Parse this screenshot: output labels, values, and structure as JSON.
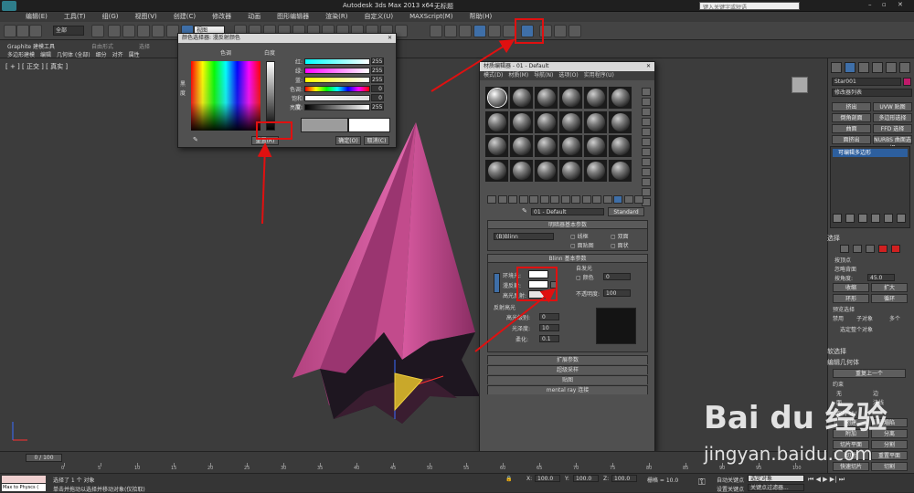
{
  "window": {
    "title": "Autodesk 3ds Max  2013 x64",
    "doc_title": "无标题",
    "search_placeholder": "键入关键字或短语"
  },
  "menu": [
    "编辑(E)",
    "工具(T)",
    "组(G)",
    "视图(V)",
    "创建(C)",
    "修改器",
    "动画",
    "图形编辑器",
    "渲染(R)",
    "自定义(U)",
    "MAXScript(M)",
    "帮助(H)"
  ],
  "toolbar": {
    "selection_filter": "全部",
    "view_dropdown": "视图"
  },
  "ribbon": {
    "tabs": [
      "Graphite 建模工具",
      "自由形式",
      "选择"
    ],
    "subtabs": [
      "多边形建模",
      "编辑",
      "几何体 (全部)",
      "细分",
      "对齐",
      "属性"
    ]
  },
  "viewport": {
    "label": "[ + ] [ 正交 ] [ 真实 ]"
  },
  "color_picker": {
    "title": "颜色选择器: 漫反射颜色",
    "hue_label": "色调",
    "whiteness_label": "白度",
    "black_label": "黑",
    "degree_label": "度",
    "sliders": [
      {
        "label": "红:",
        "value": "255"
      },
      {
        "label": "绿:",
        "value": "255"
      },
      {
        "label": "蓝:",
        "value": "255"
      },
      {
        "label": "色调:",
        "value": "0"
      },
      {
        "label": "饱和度:",
        "value": "0"
      },
      {
        "label": "亮度:",
        "value": "255"
      }
    ],
    "reset_label": "重置(R)",
    "ok_label": "确定(O)",
    "cancel_label": "取消(C)"
  },
  "material_editor": {
    "title": "材质编辑器 - 01 - Default",
    "menus": [
      "模式(D)",
      "材质(M)",
      "导航(N)",
      "选项(O)",
      "实用程序(U)"
    ],
    "material_name": "01 - Default",
    "material_type": "Standard",
    "shader_rollout": "明暗器基本参数",
    "shader": "(B)Blinn",
    "shader_options": [
      "线框",
      "双面",
      "面贴图",
      "面状"
    ],
    "blinn_rollout": "Blinn 基本参数",
    "self_illum": "自发光",
    "self_illum_color": "颜色",
    "self_illum_value": "0",
    "ambient_label": "环境光:",
    "diffuse_label": "漫反射:",
    "specular_label": "高光反射:",
    "opacity_label": "不透明度:",
    "opacity_value": "100",
    "highlight_section": "反射高光",
    "spec_level_label": "高光级别:",
    "spec_level_value": "0",
    "gloss_label": "光泽度:",
    "gloss_value": "10",
    "soften_label": "柔化:",
    "soften_value": "0.1",
    "rollouts": [
      "扩展参数",
      "超级采样",
      "贴图",
      "mental ray 连接"
    ]
  },
  "command_panel": {
    "object_name": "Star001",
    "modifier_list": "修改器列表",
    "buttons": [
      "挤出",
      "UVW 贴图",
      "倒角剖面",
      "多边形选择",
      "曲面",
      "FFD 选择",
      "面挤出",
      "NURBS 曲面选择"
    ],
    "stack_item": "可编辑多边形",
    "selection_rollout": "选择",
    "selection_opts": [
      "按顶点",
      "忽略背面",
      "按角度:"
    ],
    "angle_value": "45.0",
    "shrink": "收缩",
    "grow": "扩大",
    "ring": "环形",
    "loop": "循环",
    "preview_label": "预览选择",
    "preview_opts": [
      "禁用",
      "子对象",
      "多个"
    ],
    "selected_info": "选定整个对象",
    "soft_select": "软选择",
    "edit_geometry": "编辑几何体",
    "repeat_last": "重复上一个",
    "constraints": "约束",
    "constraint_opts": [
      "无",
      "边",
      "面",
      "法线"
    ],
    "keep_uv": "保持 UV",
    "create": "创建",
    "collapse": "塌陷",
    "attach": "附加",
    "detach": "分离",
    "slice_plane": "切片平面",
    "split": "分割",
    "slice": "切片",
    "reset_plane": "重置平面",
    "quickslice": "快速切片",
    "cut": "切割"
  },
  "timeline": {
    "frame_counter": "0 / 100",
    "ticks": [
      "0",
      "5",
      "10",
      "15",
      "20",
      "25",
      "30",
      "35",
      "40",
      "45",
      "50",
      "55",
      "60",
      "65",
      "70",
      "75",
      "80",
      "85",
      "90",
      "95",
      "100"
    ]
  },
  "status": {
    "script_box": "Max to Physcs (",
    "selected": "选择了 1 个 对象",
    "hint": "单击并拖动以选择并移动对象(仅拾取)",
    "x_value": "100.0",
    "y_value": "100.0",
    "z_value": "100.0",
    "grid": "栅格 = 10.0",
    "auto_key": "自动关键点",
    "selected_set": "选定对象",
    "set_key": "设置关键点",
    "key_filter": "关键点过滤器..."
  },
  "watermark": {
    "brand": "Bai du 经验",
    "url": "jingyan.baidu.com"
  },
  "colors": {
    "highlight_red": "#e01010",
    "object_pink": "#d0549a",
    "selection_blue": "#2d5f9e"
  }
}
